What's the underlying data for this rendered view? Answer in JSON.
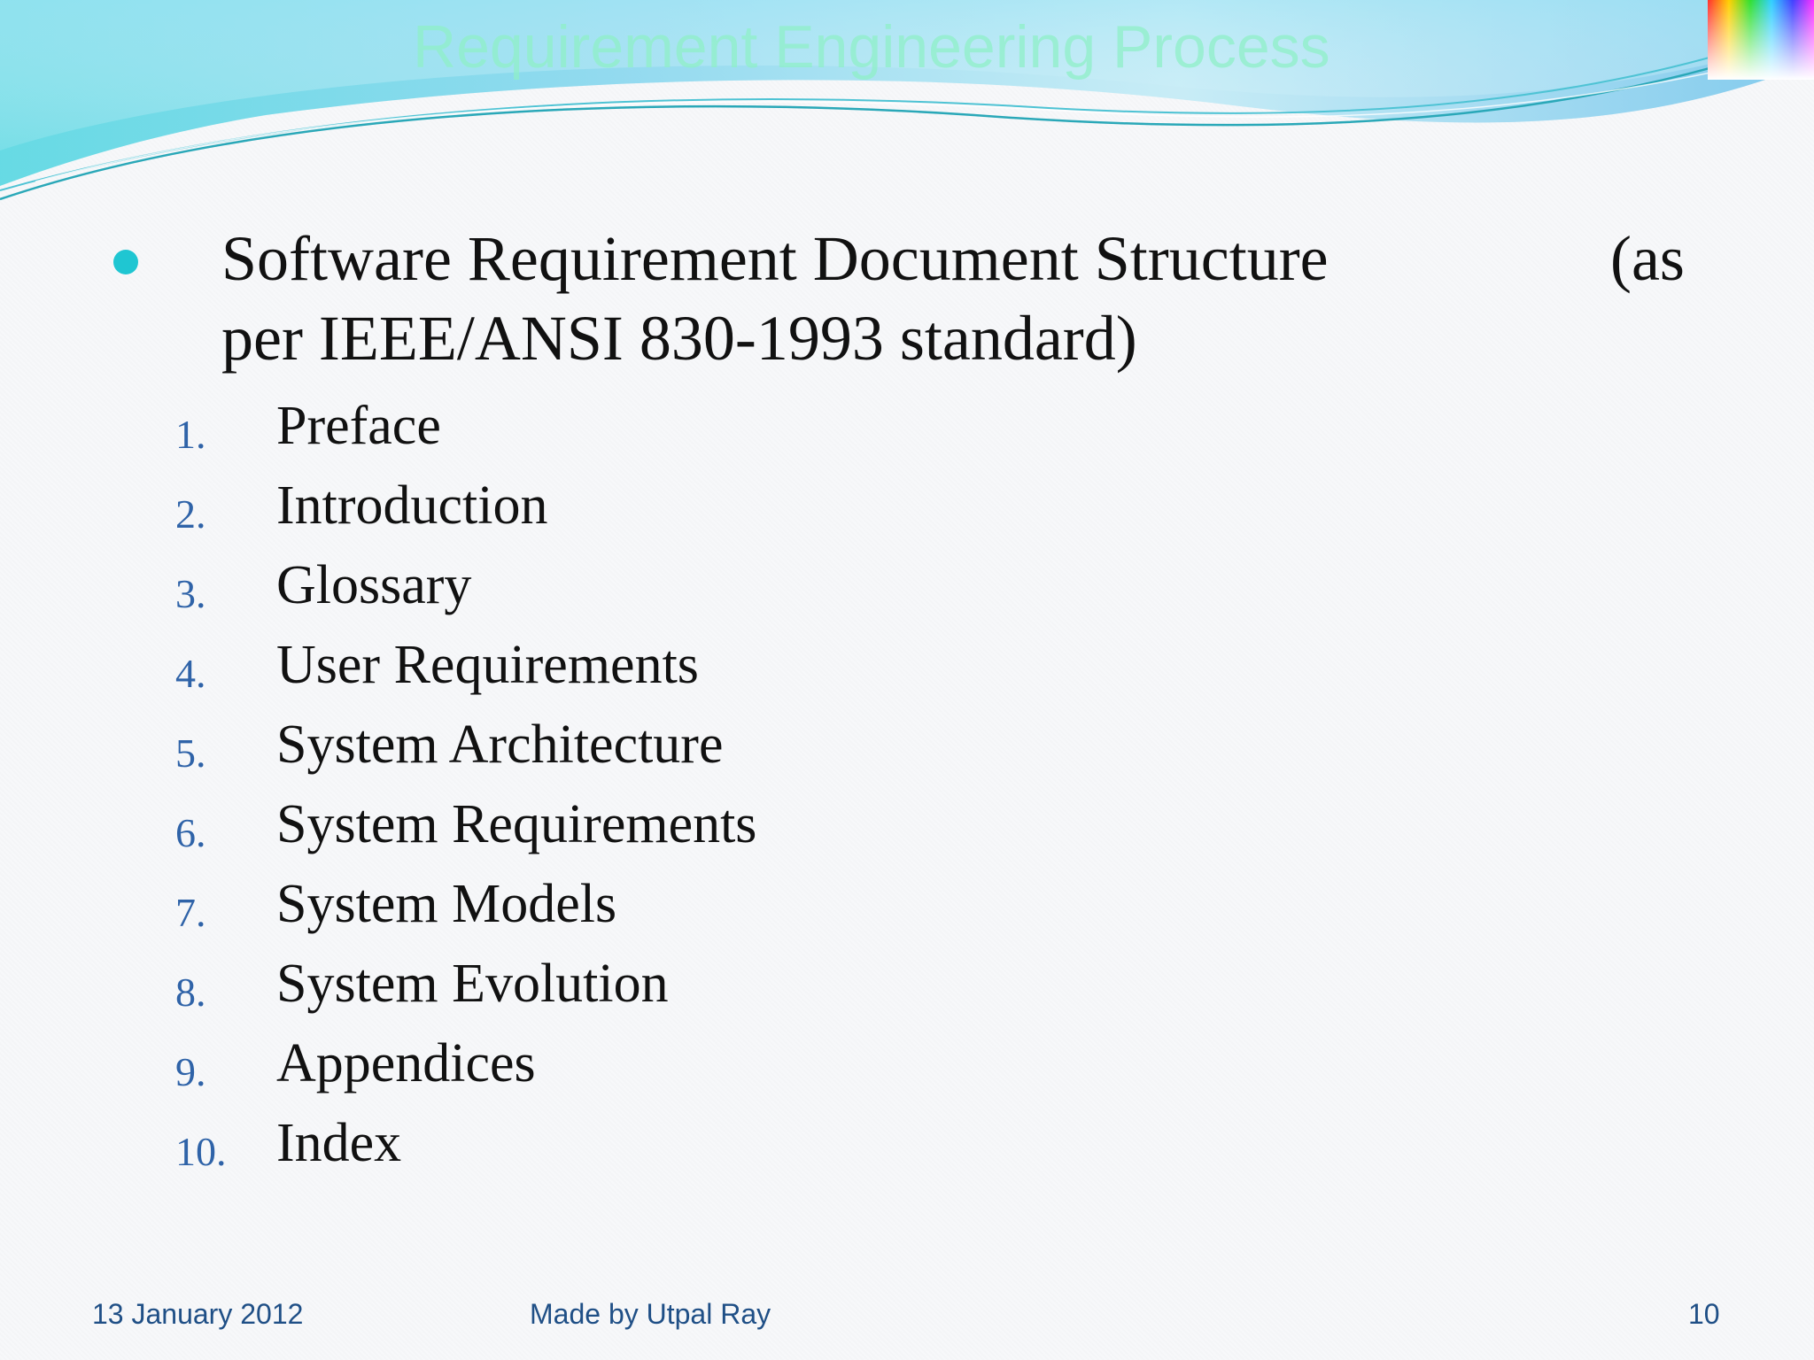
{
  "slide": {
    "title": "Requirement Engineering Process",
    "heading_line1": "Software Requirement Document Structure",
    "heading_as": "(as",
    "heading_line2": "per IEEE/ANSI 830-1993 standard)",
    "items": [
      {
        "num": "1.",
        "label": "Preface"
      },
      {
        "num": "2.",
        "label": "Introduction"
      },
      {
        "num": "3.",
        "label": "Glossary"
      },
      {
        "num": "4.",
        "label": "User Requirements"
      },
      {
        "num": "5.",
        "label": "System Architecture"
      },
      {
        "num": "6.",
        "label": "System Requirements"
      },
      {
        "num": "7.",
        "label": "System Models"
      },
      {
        "num": "8.",
        "label": "System Evolution"
      },
      {
        "num": "9.",
        "label": "Appendices"
      },
      {
        "num": "10.",
        "label": "Index"
      }
    ]
  },
  "footer": {
    "date": "13 January 2012",
    "author": "Made by Utpal Ray",
    "page": "10"
  },
  "colors": {
    "bullet": "#1fc6d2",
    "number": "#2f63a8",
    "footer_text": "#1f4f86",
    "title_text": "#8ff0c8"
  }
}
